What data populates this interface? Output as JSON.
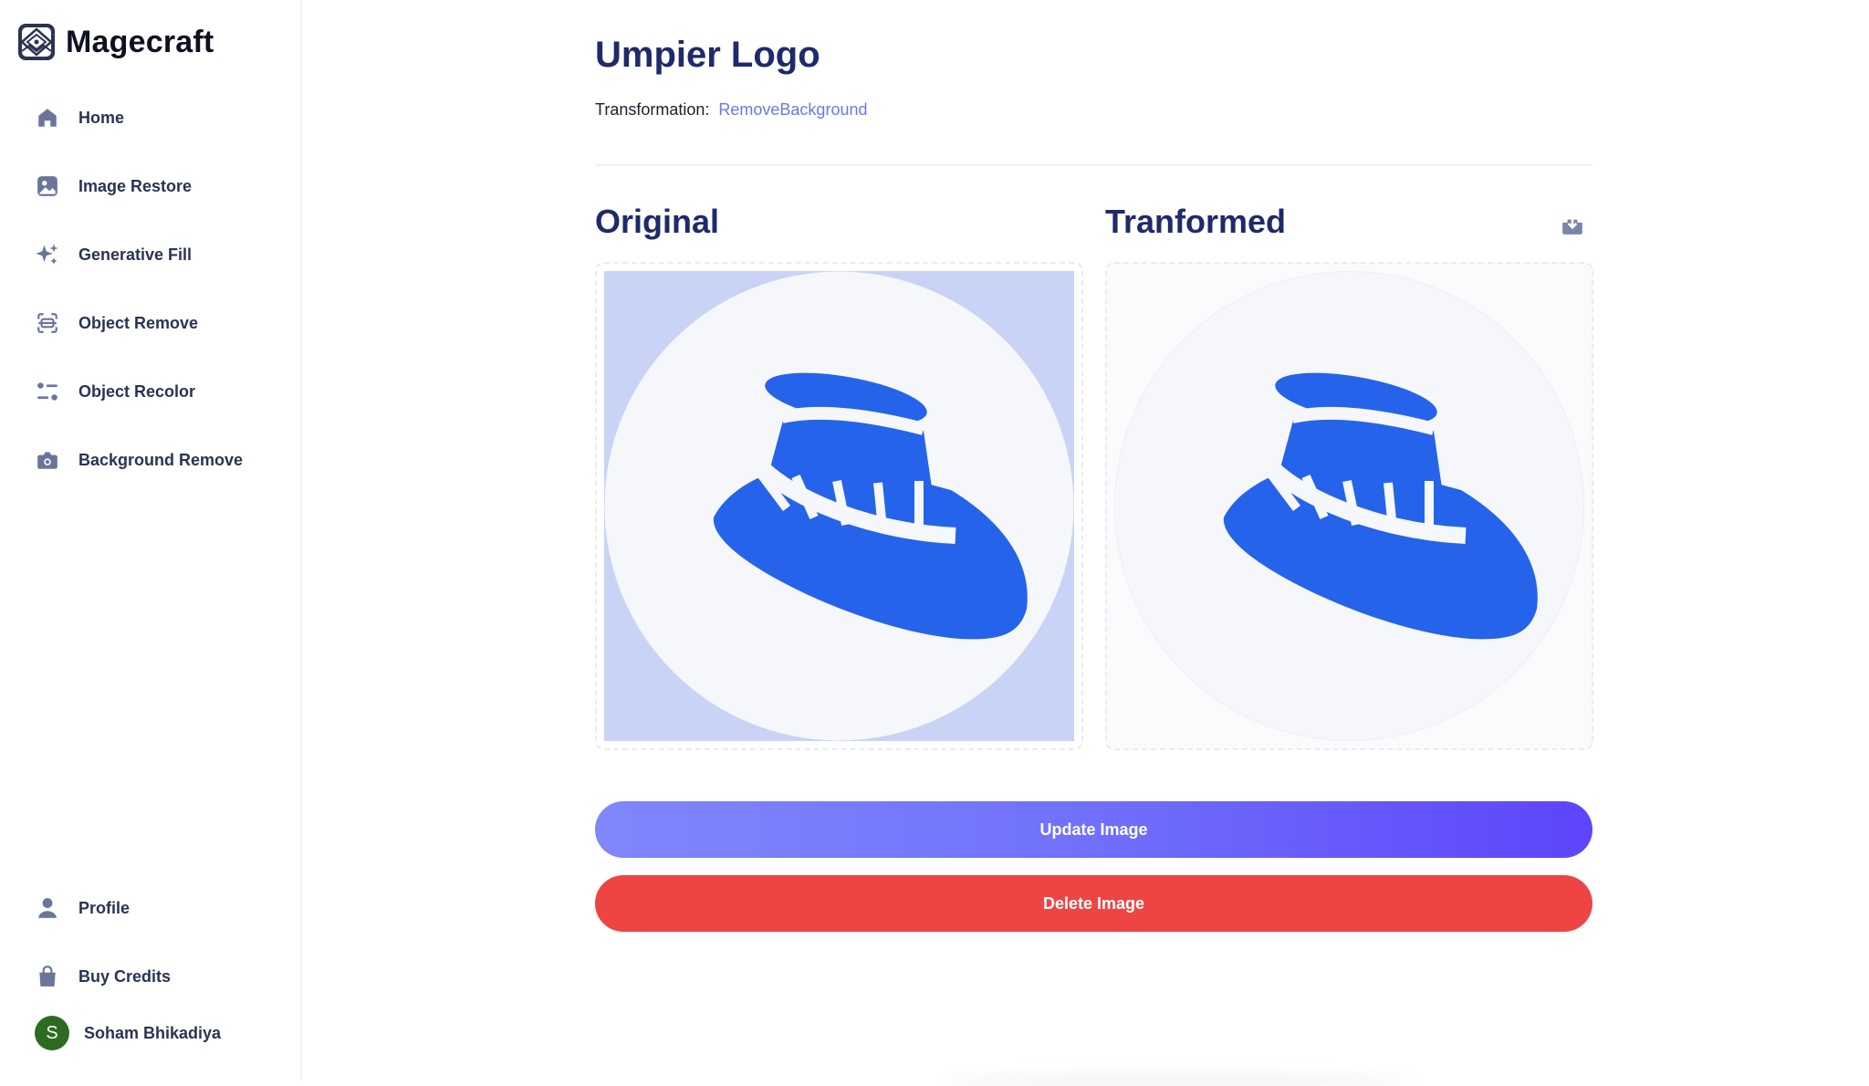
{
  "app": {
    "name": "Magecraft"
  },
  "sidebar": {
    "items": [
      {
        "label": "Home",
        "icon": "home-icon"
      },
      {
        "label": "Image Restore",
        "icon": "image-icon"
      },
      {
        "label": "Generative Fill",
        "icon": "sparkles-icon"
      },
      {
        "label": "Object Remove",
        "icon": "scan-icon"
      },
      {
        "label": "Object Recolor",
        "icon": "filter-icon"
      },
      {
        "label": "Background Remove",
        "icon": "camera-icon"
      }
    ],
    "bottom_items": [
      {
        "label": "Profile",
        "icon": "user-icon"
      },
      {
        "label": "Buy Credits",
        "icon": "bag-icon"
      }
    ],
    "user": {
      "initial": "S",
      "name": "Soham Bhikadiya",
      "avatar_color": "#2e6b22"
    }
  },
  "page": {
    "title": "Umpier Logo",
    "transformation_label": "Transformation:",
    "transformation_value": "RemoveBackground"
  },
  "panels": {
    "original_title": "Original",
    "transformed_title": "Tranformed"
  },
  "actions": {
    "update_label": "Update Image",
    "delete_label": "Delete Image"
  },
  "colors": {
    "accent": "#6a78e8",
    "title": "#1f2a6b",
    "hat_blue": "#2563eb",
    "original_bg": "#c9d3f5",
    "delete_red": "#ef4444"
  }
}
